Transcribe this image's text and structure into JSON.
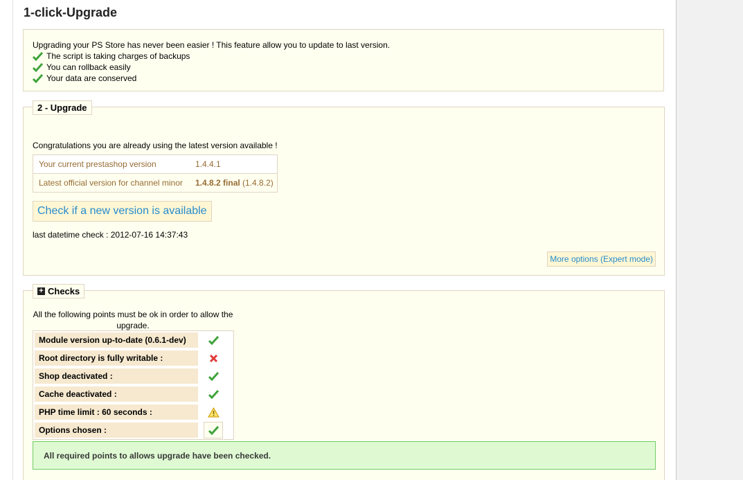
{
  "page": {
    "title": "1-click-Upgrade"
  },
  "intro": {
    "text": "Upgrading your PS Store has never been easier ! This feature allow you to update to last version.",
    "features": [
      "The script is taking charges of backups",
      "You can rollback easily",
      "Your data are conserved"
    ]
  },
  "upgrade": {
    "legend": "2 - Upgrade",
    "congrats": "Congratulations you are already using the latest version available !",
    "rows": [
      {
        "label": "Your current prestashop version",
        "value": "1.4.4.1",
        "extra": ""
      },
      {
        "label": "Latest official version for channel minor",
        "value": "1.4.8.2 final",
        "extra": "(1.4.8.2)"
      }
    ],
    "check_button": "Check if a new version is available",
    "last_check_label": "last datetime check : 2012-07-16 14:37:43",
    "expert_button": "More options (Expert mode)"
  },
  "checks": {
    "legend": "Checks",
    "intro": "All the following points must be ok in order to allow the upgrade.",
    "items": [
      {
        "label": "Module version up-to-date (0.6.1-dev)",
        "status": "ok"
      },
      {
        "label": "Root directory is fully writable :",
        "status": "error"
      },
      {
        "label": "Shop deactivated :",
        "status": "ok"
      },
      {
        "label": "Cache deactivated :",
        "status": "ok"
      },
      {
        "label": "PHP time limit : 60 seconds :",
        "status": "warning"
      },
      {
        "label": "Options chosen :",
        "status": "ok"
      }
    ],
    "success": "All required points to allows upgrade have been checked."
  },
  "colors": {
    "ok": "#3fa33c",
    "error": "#e03a3a",
    "warning": "#e8b400",
    "link": "#268ccd",
    "box_bg": "#fffff0"
  }
}
